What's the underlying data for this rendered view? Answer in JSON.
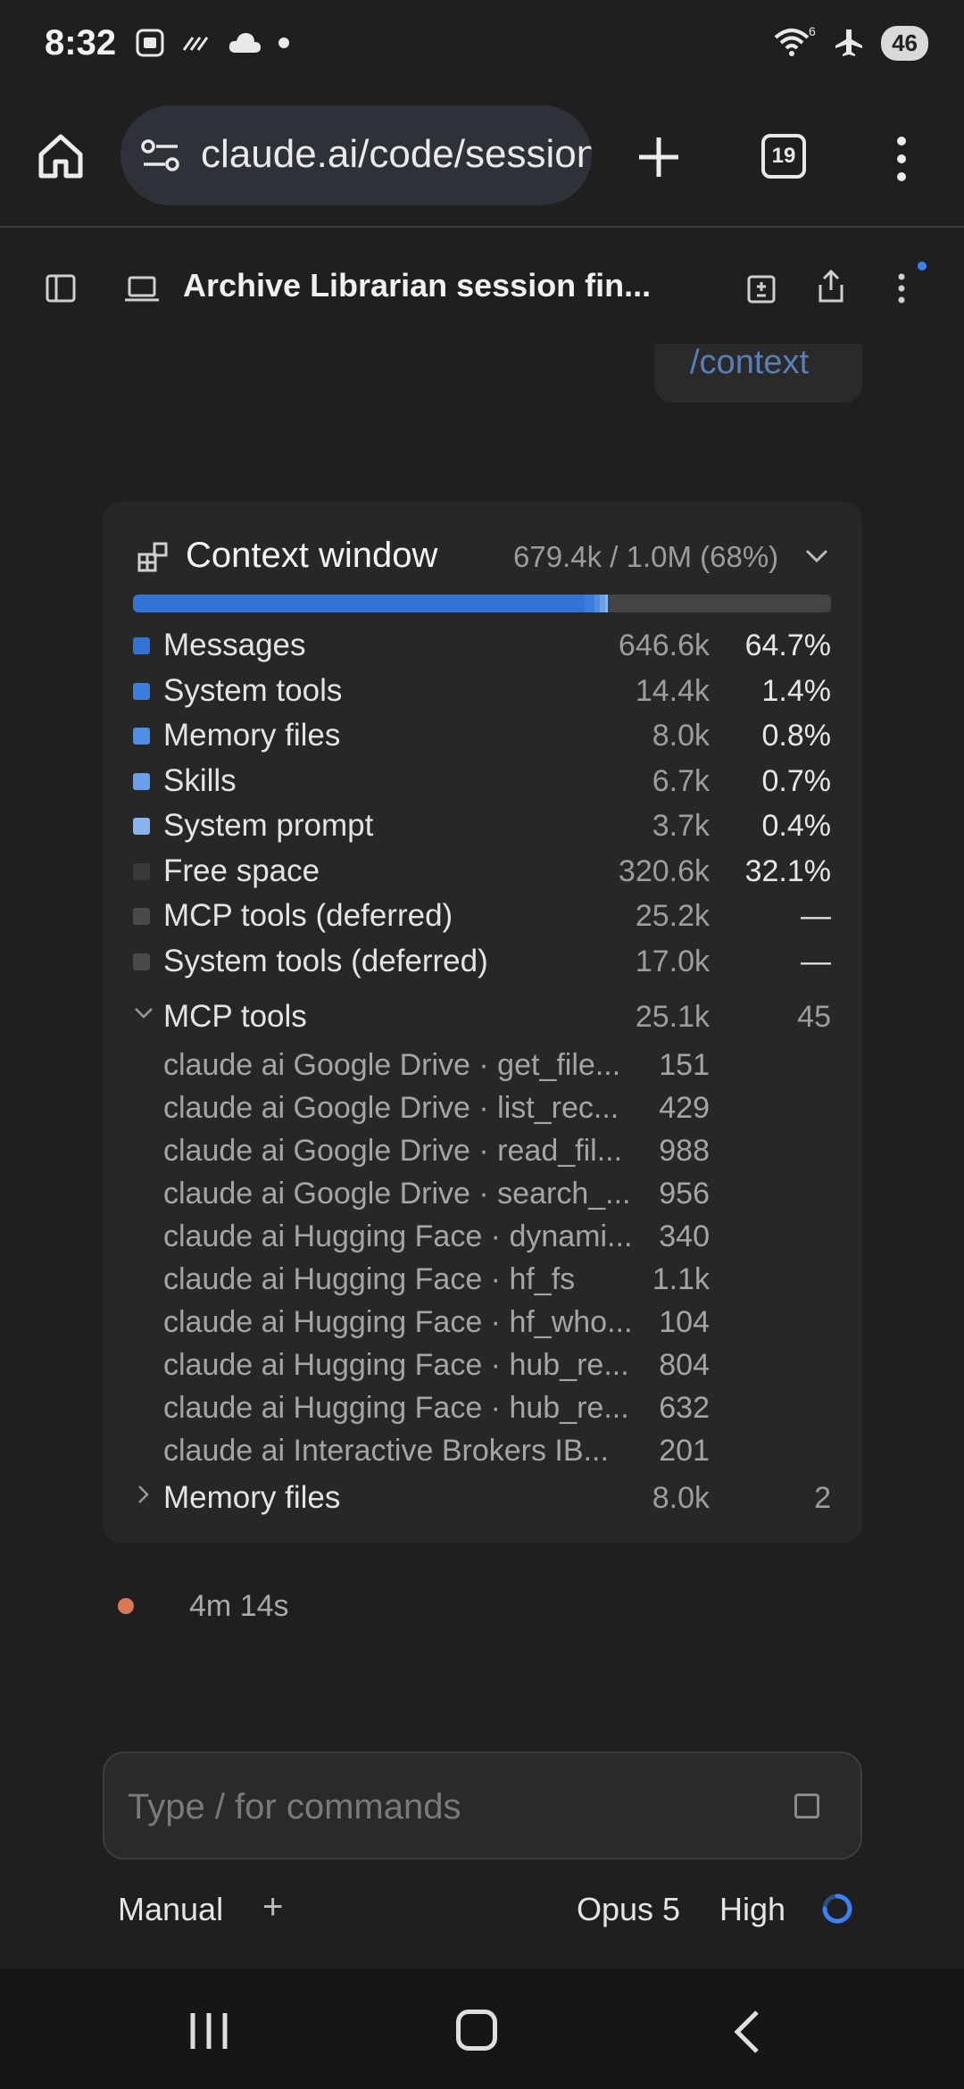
{
  "status_bar": {
    "time": "8:32",
    "wifi_badge": "6",
    "battery": "46"
  },
  "browser": {
    "url": "claude.ai/code/session_",
    "tab_count": "19"
  },
  "header": {
    "title": "Archive Librarian session fin..."
  },
  "command_bubble": {
    "text": "/context"
  },
  "context": {
    "title": "Context window",
    "summary": "679.4k / 1.0M (68%)",
    "usage_fraction": 0.679,
    "colors": {
      "messages": "#3174d6",
      "system_tools": "#3a7ee0",
      "memory_files": "#4f8de6",
      "skills": "#6a9fea",
      "system_prompt": "#8ab4f0",
      "free_space": "#3a3a3a",
      "deferred": "#4a4a4a"
    },
    "rows": [
      {
        "label": "Messages",
        "value": "646.6k",
        "pct": "64.7%"
      },
      {
        "label": "System tools",
        "value": "14.4k",
        "pct": "1.4%"
      },
      {
        "label": "Memory files",
        "value": "8.0k",
        "pct": "0.8%"
      },
      {
        "label": "Skills",
        "value": "6.7k",
        "pct": "0.7%"
      },
      {
        "label": "System prompt",
        "value": "3.7k",
        "pct": "0.4%"
      },
      {
        "label": "Free space",
        "value": "320.6k",
        "pct": "32.1%"
      },
      {
        "label": "MCP tools (deferred)",
        "value": "25.2k",
        "pct": "—"
      },
      {
        "label": "System tools (deferred)",
        "value": "17.0k",
        "pct": "—"
      }
    ],
    "mcp_tools": {
      "label": "MCP tools",
      "value": "25.1k",
      "count": "45",
      "items": [
        {
          "name": "claude ai Google Drive · get_file...",
          "value": "151"
        },
        {
          "name": "claude ai Google Drive · list_rec...",
          "value": "429"
        },
        {
          "name": "claude ai Google Drive · read_fil...",
          "value": "988"
        },
        {
          "name": "claude ai Google Drive · search_...",
          "value": "956"
        },
        {
          "name": "claude ai Hugging Face · dynami...",
          "value": "340"
        },
        {
          "name": "claude ai Hugging Face · hf_fs",
          "value": "1.1k"
        },
        {
          "name": "claude ai Hugging Face · hf_who...",
          "value": "104"
        },
        {
          "name": "claude ai Hugging Face · hub_re...",
          "value": "804"
        },
        {
          "name": "claude ai Hugging Face · hub_re...",
          "value": "632"
        },
        {
          "name": "claude ai Interactive Brokers IB...",
          "value": "201"
        }
      ]
    },
    "memory_files": {
      "label": "Memory files",
      "value": "8.0k",
      "count": "2"
    }
  },
  "timer": {
    "text": "4m 14s"
  },
  "composer": {
    "placeholder": "Type / for commands",
    "mode": "Manual",
    "add": "+",
    "model": "Opus 5",
    "effort": "High"
  }
}
